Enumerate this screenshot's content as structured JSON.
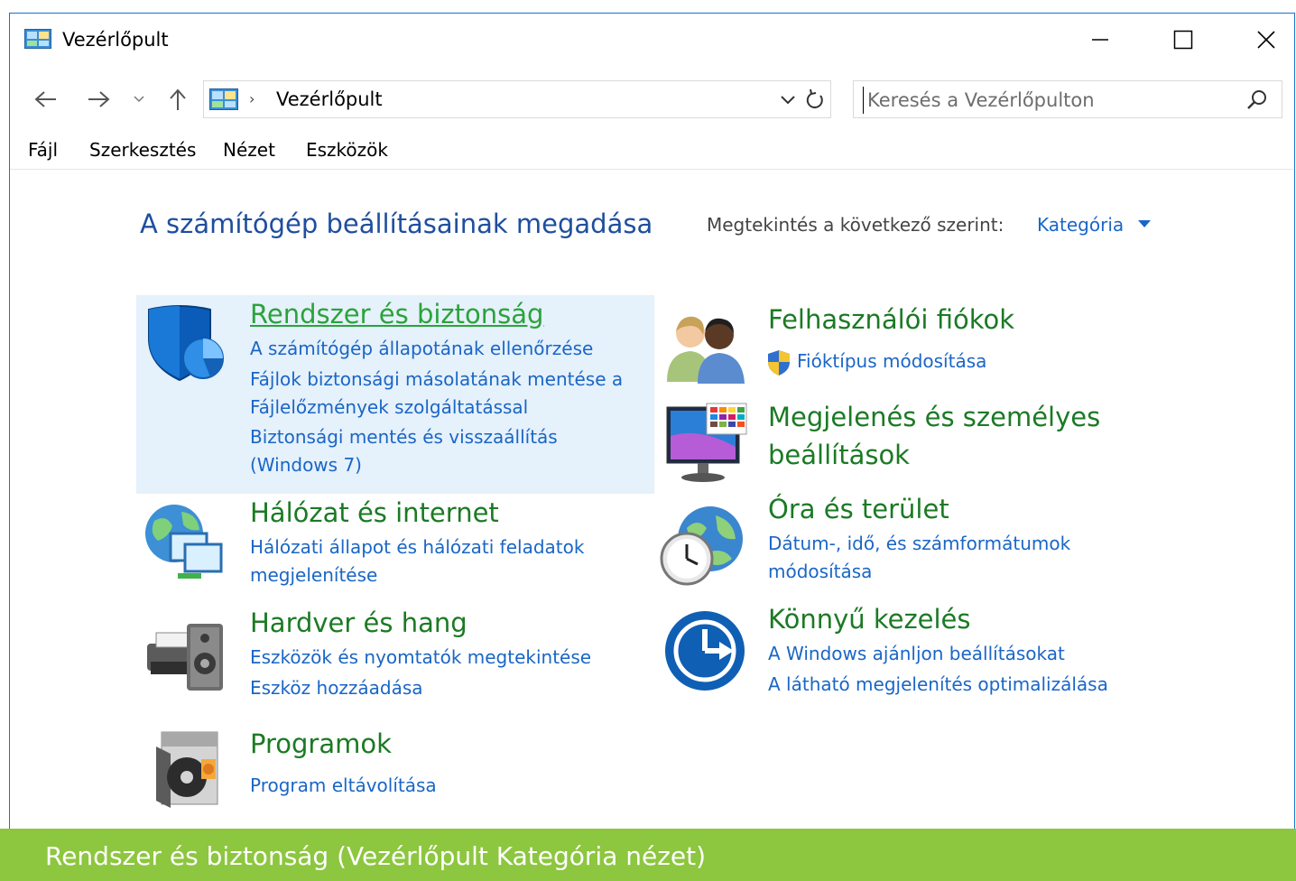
{
  "window": {
    "title": "Vezérlőpult"
  },
  "address": {
    "path": "Vezérlőpult",
    "separator": "›"
  },
  "search": {
    "placeholder": "Keresés a Vezérlőpulton"
  },
  "menu": {
    "file": "Fájl",
    "edit": "Szerkesztés",
    "view": "Nézet",
    "tools": "Eszközök"
  },
  "content": {
    "heading": "A számítógép beállításainak megadása",
    "view_by_label": "Megtekintés a következő szerint:",
    "view_by_value": "Kategória"
  },
  "categories": {
    "system": {
      "title": "Rendszer és biztonság",
      "links": [
        "A számítógép állapotának ellenőrzése",
        "Fájlok biztonsági másolatának mentése a Fájlelőzmények szolgáltatással",
        "Biztonsági mentés és visszaállítás (Windows 7)"
      ]
    },
    "network": {
      "title": "Hálózat és internet",
      "links": [
        "Hálózati állapot és hálózati feladatok megjelenítése"
      ]
    },
    "hardware": {
      "title": "Hardver és hang",
      "links": [
        "Eszközök és nyomtatók megtekintése",
        "Eszköz hozzáadása"
      ]
    },
    "programs": {
      "title": "Programok",
      "links": [
        "Program eltávolítása"
      ]
    },
    "users": {
      "title": "Felhasználói fiókok",
      "links": [
        "Fióktípus módosítása"
      ]
    },
    "appearance": {
      "title": "Megjelenés és személyes beállítások",
      "links": []
    },
    "clock": {
      "title": "Óra és terület",
      "links": [
        "Dátum-, idő, és számformátumok módosítása"
      ]
    },
    "ease": {
      "title": "Könnyű kezelés",
      "links": [
        "A Windows ajánljon beállításokat",
        "A látható megjelenítés optimalizálása"
      ]
    }
  },
  "caption": "Rendszer és biztonság (Vezérlőpult Kategória nézet)",
  "colors": {
    "category_title": "#1b7a24",
    "link": "#1a66c6",
    "heading": "#1e4e9e",
    "hover_bg": "#e5f1fb",
    "caption_bar": "#8dc63f"
  }
}
